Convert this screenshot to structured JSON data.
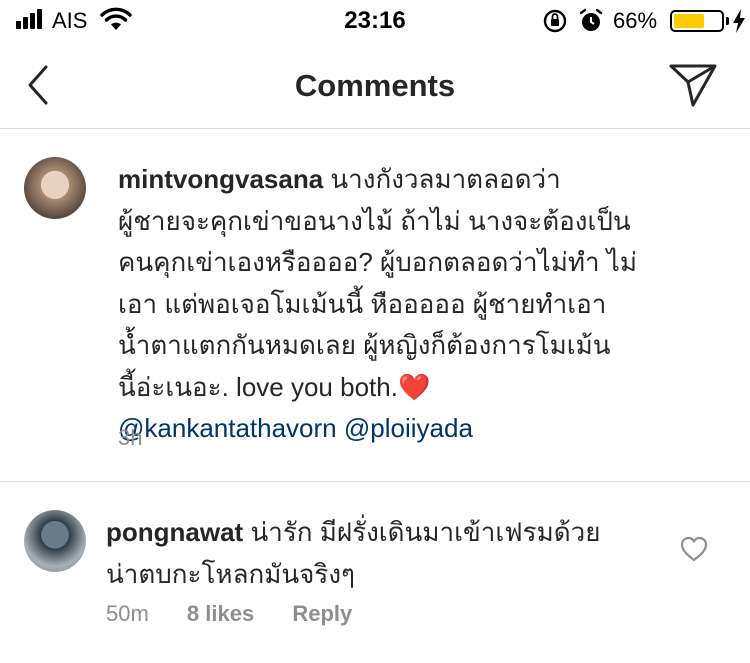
{
  "status_bar": {
    "carrier": "AIS",
    "time": "23:16",
    "battery_percent": "66%",
    "battery_level": 0.66
  },
  "header": {
    "title": "Comments"
  },
  "comments": [
    {
      "username": "mintvongvasana",
      "lines": [
        "นางกังวลมาตลอดว่า",
        "ผู้ชายจะคุกเข่าขอนางไม้ ถ้าไม่ นางจะต้องเป็น",
        "คนคุกเข่าเองหรืออออ?  ผู้บอกตลอดว่าไม่ทำ ไม่",
        "เอา  แต่พอเจอโมเม้นนี้ หือออออ ผู้ชายทำเอา",
        "น้ำตาแตกกันหมดเลย ผู้หญิงก็ต้องการโมเม้น",
        "นี้อ่ะเนอะ. love you both."
      ],
      "heart_emoji": "❤️",
      "mentions": [
        "@kankantathavorn",
        "@ploiiyada"
      ],
      "time": "3h"
    },
    {
      "username": "pongnawat",
      "lines": [
        "น่ารัก มีฝรั่งเดินมาเข้าเฟรมด้วย",
        "น่าตบกะโหลกมันจริงๆ"
      ],
      "time": "50m",
      "likes": "8 likes",
      "reply": "Reply"
    }
  ]
}
